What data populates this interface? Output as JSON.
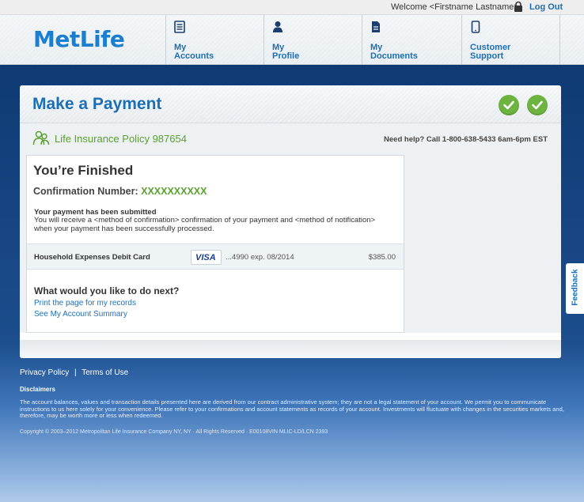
{
  "topbar": {
    "welcome": "Welcome <Firstname Lastname>",
    "logout": "Log Out"
  },
  "header": {
    "logo": "MetLife",
    "nav": [
      {
        "line1": "My",
        "line2": "Accounts",
        "icon": "list-icon"
      },
      {
        "line1": "My",
        "line2": "Profile",
        "icon": "person-icon"
      },
      {
        "line1": "My",
        "line2": "Documents",
        "icon": "document-icon"
      },
      {
        "line1": "Customer",
        "line2": "Support",
        "icon": "phone-icon"
      }
    ]
  },
  "panel": {
    "title": "Make a Payment",
    "policy": "Life Insurance Policy 987654",
    "help": "Need help? Call 1-800-638-5433 6am-6pm EST"
  },
  "card": {
    "finished": "You’re Finished",
    "confirmation_label": "Confirmation Number: ",
    "confirmation_value": "XXXXXXXXXX",
    "submitted_title": "Your payment has been submitted",
    "submitted_body": "You will receive a <method of confirmation> confirmation of your payment and <method of notification> when your payment has been successfully processed.",
    "payment": {
      "name": "Household Expenses Debit Card",
      "brand": "VISA",
      "number": "...4990  exp. 08/2014",
      "amount": "$385.00"
    },
    "next_title": "What would you like to do next?",
    "links": [
      "Print the page for my records",
      "See My Account Summary"
    ]
  },
  "feedback": "Feedback",
  "footer": {
    "privacy": "Privacy Policy",
    "separator": "|",
    "terms": "Terms of Use",
    "disclaimers_title": "Disclaimers",
    "disclaimers_body": "The account balances, values and transaction details presented here are derived from our contract administrative system; they are not a legal statement of your account. We permit you to communicate instructions to us here solely for your convenience. Please refer to your confirmations and account statements as records of your account. Investments will fluctuate with changes in the securities markets and, therefore, may be worth more or less when redeemed.",
    "copyright": "Copyright © 2003–2012 Metropolitan Life Insurance Company NY, NY · All Rights Reserved · E00108VIN MLIC-LD/LCN 2393"
  },
  "colors": {
    "brand_blue": "#1c6fb5",
    "success_green": "#6cb33f",
    "background_navy": "#0f3a73"
  }
}
